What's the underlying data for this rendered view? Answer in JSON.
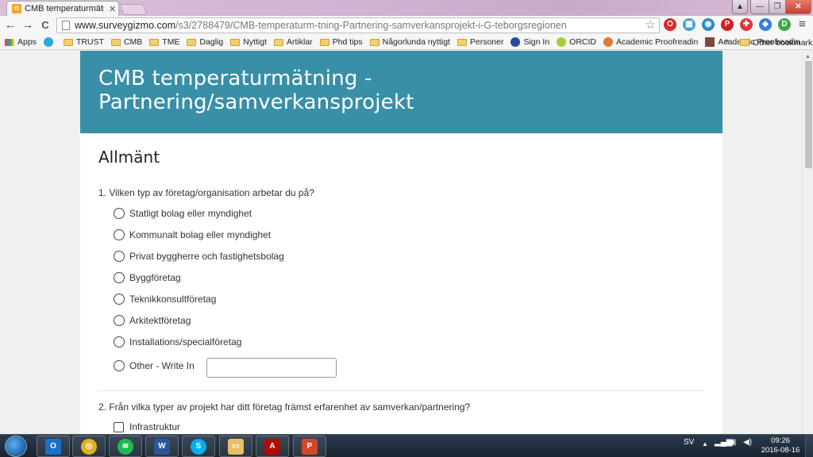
{
  "browser": {
    "tab_title": "CMB temperaturmätning",
    "tab_close": "✕",
    "url_host": "www.surveygizmo.com",
    "url_path": "/s3/2788479/CMB-temperaturm-tning-Partnering-samverkansprojekt-i-G-teborgsregionen",
    "window_controls": {
      "minimize": "—",
      "maximize": "❐",
      "close": "✕",
      "user": "▲"
    },
    "nav": {
      "back": "←",
      "forward": "→",
      "reload": "C"
    },
    "bookmarks": [
      {
        "label": "Apps",
        "icon": "apps-grid-icon"
      },
      {
        "label": "",
        "icon": "vr-circle-icon"
      },
      {
        "label": "TRUST",
        "icon": "folder-icon"
      },
      {
        "label": "CMB",
        "icon": "folder-icon"
      },
      {
        "label": "TME",
        "icon": "folder-icon"
      },
      {
        "label": "Daglig",
        "icon": "folder-icon"
      },
      {
        "label": "Nyttigt",
        "icon": "folder-icon"
      },
      {
        "label": "Artiklar",
        "icon": "folder-icon"
      },
      {
        "label": "Phd tips",
        "icon": "folder-icon"
      },
      {
        "label": "Någorlunda nyttigt",
        "icon": "folder-icon"
      },
      {
        "label": "Personer",
        "icon": "folder-icon"
      },
      {
        "label": "Sign In",
        "icon": "s-circle-icon"
      },
      {
        "label": "ORCID",
        "icon": "orcid-icon"
      },
      {
        "label": "Academic Proofreadin",
        "icon": "proofreading-icon"
      },
      {
        "label": "Academic Proofreadin",
        "icon": "proofreading-grid-icon"
      }
    ],
    "bookmarks_overflow": "»",
    "other_bookmarks": "Other bookmarks",
    "extensions": [
      {
        "name": "opera-icon",
        "glyph": "O",
        "color": "#e0252b"
      },
      {
        "name": "colorful-grid-icon",
        "glyph": "▦",
        "color": "#4aa0d8"
      },
      {
        "name": "eye-circle-icon",
        "glyph": "◉",
        "color": "#2a8ac8"
      },
      {
        "name": "pinterest-icon",
        "glyph": "P",
        "color": "#cb2027"
      },
      {
        "name": "red-cross-icon",
        "glyph": "✚",
        "color": "#d83a3a"
      },
      {
        "name": "blue-diamond-icon",
        "glyph": "◆",
        "color": "#2f7fe0"
      },
      {
        "name": "green-d-icon",
        "glyph": "D",
        "color": "#3aa845"
      }
    ]
  },
  "survey": {
    "title_line1": "CMB temperaturmätning -",
    "title_line2": "Partnering/samverkansprojekt",
    "section": "Allmänt",
    "accent_color": "#3a8fa8",
    "q1": {
      "text": "1. Vilken typ av företag/organisation arbetar du på?",
      "options": [
        "Statligt bolag eller myndighet",
        "Kommunalt bolag eller myndighet",
        "Privat byggherre och fastighetsbolag",
        "Byggföretag",
        "Teknikkonsultföretag",
        "Arkitektföretag",
        "Installations/specialföretag",
        "Other - Write In"
      ],
      "write_in_value": ""
    },
    "q2": {
      "text": "2. Från vilka typer av projekt har ditt företag främst erfarenhet av samverkan/partnering?",
      "options": [
        "Infrastruktur"
      ]
    }
  },
  "taskbar": {
    "apps": [
      {
        "name": "outlook-icon",
        "glyph": "O",
        "color": "#1a6fc8"
      },
      {
        "name": "chrome-icon",
        "glyph": "◎",
        "color": "#e0b020"
      },
      {
        "name": "spotify-icon",
        "glyph": "≋",
        "color": "#1db954"
      },
      {
        "name": "word-icon",
        "glyph": "W",
        "color": "#2b5797"
      },
      {
        "name": "skype-icon",
        "glyph": "S",
        "color": "#00aff0"
      },
      {
        "name": "file-explorer-icon",
        "glyph": "▭",
        "color": "#e8c060"
      },
      {
        "name": "acrobat-icon",
        "glyph": "A",
        "color": "#b30b00"
      },
      {
        "name": "powerpoint-icon",
        "glyph": "P",
        "color": "#d24726"
      }
    ],
    "language": "SV",
    "time": "09:26",
    "date": "2016-08-16"
  }
}
